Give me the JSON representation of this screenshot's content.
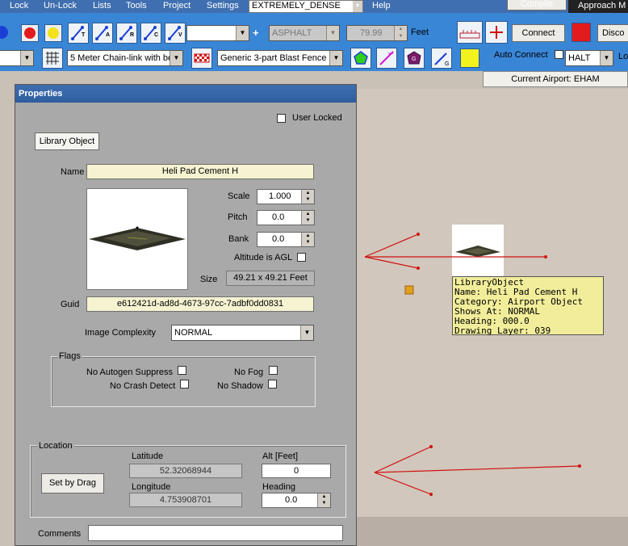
{
  "menubar": {
    "items": [
      "Lock",
      "Un-Lock",
      "Lists",
      "Tools",
      "Project",
      "Settings",
      "Help"
    ],
    "density_value": "EXTREMELY_DENSE",
    "compile_label": "Compile",
    "approach_label": "Approach M"
  },
  "toolbar": {
    "row1_buttons": [
      "T",
      "A",
      "R",
      "C",
      "V"
    ],
    "plus_label": "+",
    "surface_value": "ASPHALT",
    "number_value": "79.99",
    "unit_label": "Feet",
    "connect_label": "Connect",
    "disconnect_label": "Disco",
    "fence_value": "5 Meter Chain-link with ber",
    "blast_fence_value": "Generic 3-part Blast Fence",
    "auto_connect_label": "Auto Connect",
    "surface2_value": "HALT",
    "lo_label": "Lo"
  },
  "airport": {
    "label": "Current Airport: EHAM"
  },
  "dialog": {
    "title": "Properties",
    "user_locked_label": "User Locked",
    "library_object_label": "Library Object",
    "name_label": "Name",
    "name_value": "Heli Pad Cement H",
    "scale_label": "Scale",
    "scale_value": "1.000",
    "pitch_label": "Pitch",
    "pitch_value": "0.0",
    "bank_label": "Bank",
    "bank_value": "0.0",
    "agl_label": "Altitude is AGL",
    "size_label": "Size",
    "size_value": "49.21 x 49.21 Feet",
    "guid_label": "Guid",
    "guid_value": "e612421d-ad8d-4673-97cc-7adbf0dd0831",
    "complexity_label": "Image Complexity",
    "complexity_value": "NORMAL",
    "flags_label": "Flags",
    "no_autogen_label": "No Autogen Suppress",
    "no_fog_label": "No Fog",
    "no_crash_label": "No Crash Detect",
    "no_shadow_label": "No Shadow",
    "location_label": "Location",
    "set_by_drag_label": "Set by Drag",
    "latitude_label": "Latitude",
    "latitude_value": "52.32068944",
    "longitude_label": "Longitude",
    "longitude_value": "4.753908701",
    "alt_label": "Alt [Feet]",
    "alt_value": "0",
    "heading_label": "Heading",
    "heading_value": "0.0",
    "comments_label": "Comments"
  },
  "tooltip": {
    "text": "LibraryObject\nName: Heli Pad Cement H\nCategory: Airport Object\nShows At: NORMAL\nHeading: 000.0\nDrawing Layer: 039"
  },
  "colors": {
    "toolbar_blue": "#3a86d6",
    "titlebar_blue": "#2e5e9e",
    "field_yellow": "#f6f3d2",
    "tooltip_yellow": "#f1ed9a",
    "line_red": "#d01010"
  }
}
